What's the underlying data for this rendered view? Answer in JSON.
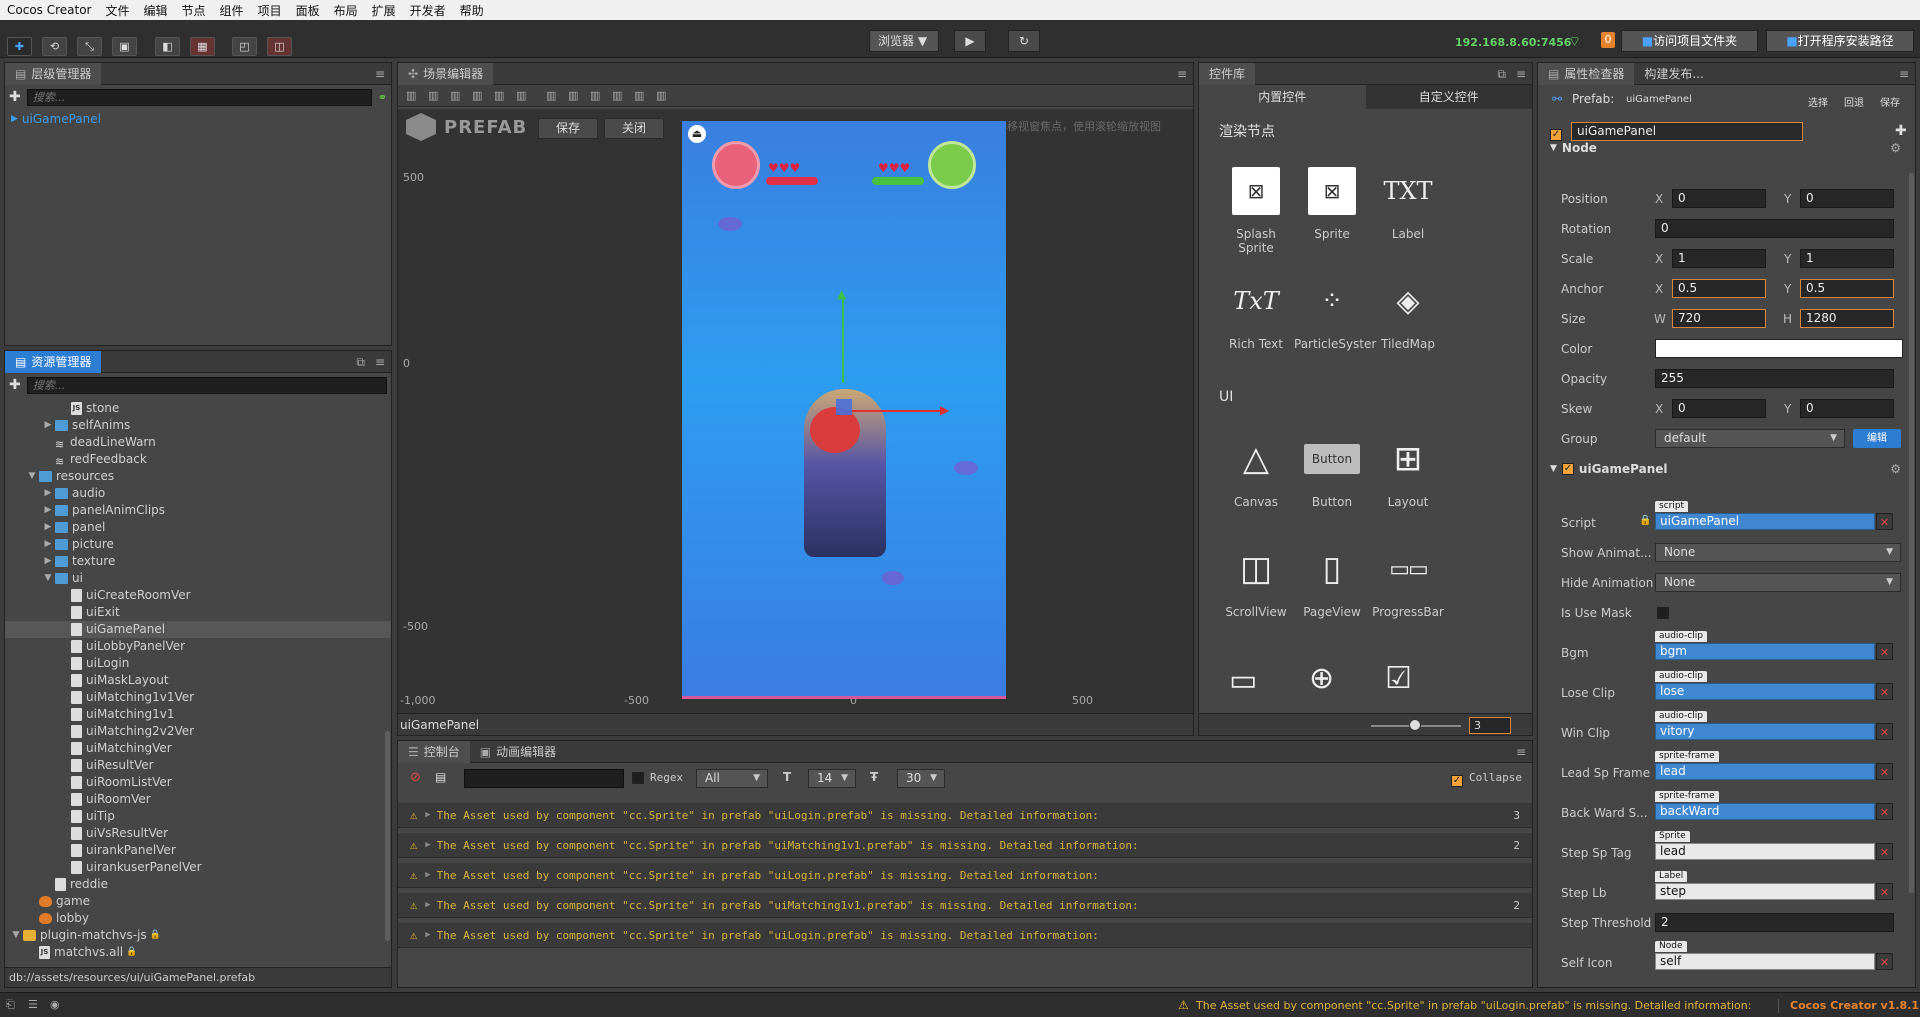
{
  "menubar": {
    "items": [
      "Cocos Creator",
      "文件",
      "编辑",
      "节点",
      "组件",
      "项目",
      "面板",
      "布局",
      "扩展",
      "开发者",
      "帮助"
    ]
  },
  "toolbar": {
    "browser_label": "浏览器",
    "ip": "192.168.8.60:7456",
    "notification_count": "0",
    "open_project_label": "访问项目文件夹",
    "open_install_label": "打开程序安装路径"
  },
  "hierarchy": {
    "title": "层级管理器",
    "search_placeholder": "搜索...",
    "root": "uiGamePanel"
  },
  "assets": {
    "title": "资源管理器",
    "search_placeholder": "搜索...",
    "items": [
      {
        "label": "stone",
        "indent": 3,
        "kind": "js",
        "fold": ""
      },
      {
        "label": "selfAnims",
        "indent": 2,
        "kind": "folder",
        "fold": "▶"
      },
      {
        "label": "deadLineWarn",
        "indent": 2,
        "kind": "anim",
        "fold": ""
      },
      {
        "label": "redFeedback",
        "indent": 2,
        "kind": "anim",
        "fold": ""
      },
      {
        "label": "resources",
        "indent": 1,
        "kind": "folder",
        "fold": "▼"
      },
      {
        "label": "audio",
        "indent": 2,
        "kind": "folder",
        "fold": "▶"
      },
      {
        "label": "panelAnimClips",
        "indent": 2,
        "kind": "folder",
        "fold": "▶"
      },
      {
        "label": "panel",
        "indent": 2,
        "kind": "folder",
        "fold": "▶"
      },
      {
        "label": "picture",
        "indent": 2,
        "kind": "folder",
        "fold": "▶"
      },
      {
        "label": "texture",
        "indent": 2,
        "kind": "folder",
        "fold": "▶"
      },
      {
        "label": "ui",
        "indent": 2,
        "kind": "folder",
        "fold": "▼"
      },
      {
        "label": "uiCreateRoomVer",
        "indent": 3,
        "kind": "file",
        "fold": ""
      },
      {
        "label": "uiExit",
        "indent": 3,
        "kind": "file",
        "fold": ""
      },
      {
        "label": "uiGamePanel",
        "indent": 3,
        "kind": "file",
        "fold": "",
        "selected": true
      },
      {
        "label": "uiLobbyPanelVer",
        "indent": 3,
        "kind": "file",
        "fold": ""
      },
      {
        "label": "uiLogin",
        "indent": 3,
        "kind": "file",
        "fold": ""
      },
      {
        "label": "uiMaskLayout",
        "indent": 3,
        "kind": "file",
        "fold": ""
      },
      {
        "label": "uiMatching1v1Ver",
        "indent": 3,
        "kind": "file",
        "fold": ""
      },
      {
        "label": "uiMatching1v1",
        "indent": 3,
        "kind": "file",
        "fold": ""
      },
      {
        "label": "uiMatching2v2Ver",
        "indent": 3,
        "kind": "file",
        "fold": ""
      },
      {
        "label": "uiMatchingVer",
        "indent": 3,
        "kind": "file",
        "fold": ""
      },
      {
        "label": "uiResultVer",
        "indent": 3,
        "kind": "file",
        "fold": ""
      },
      {
        "label": "uiRoomListVer",
        "indent": 3,
        "kind": "file",
        "fold": ""
      },
      {
        "label": "uiRoomVer",
        "indent": 3,
        "kind": "file",
        "fold": ""
      },
      {
        "label": "uiTip",
        "indent": 3,
        "kind": "file",
        "fold": ""
      },
      {
        "label": "uiVsResultVer",
        "indent": 3,
        "kind": "file",
        "fold": ""
      },
      {
        "label": "uirankPanelVer",
        "indent": 3,
        "kind": "file",
        "fold": ""
      },
      {
        "label": "uirankuserPanelVer",
        "indent": 3,
        "kind": "file",
        "fold": ""
      },
      {
        "label": "reddie",
        "indent": 2,
        "kind": "file",
        "fold": ""
      },
      {
        "label": "game",
        "indent": 1,
        "kind": "fire",
        "fold": ""
      },
      {
        "label": "lobby",
        "indent": 1,
        "kind": "fire",
        "fold": ""
      },
      {
        "label": "plugin-matchvs-js",
        "indent": 0,
        "kind": "pkg",
        "fold": "▼",
        "locked": true
      },
      {
        "label": "matchvs.all",
        "indent": 1,
        "kind": "js",
        "fold": "",
        "locked": true
      }
    ],
    "path": "db://assets/resources/ui/uiGamePanel.prefab"
  },
  "scene": {
    "title": "场景编辑器",
    "prefab_label": "PREFAB",
    "save_label": "保存",
    "close_label": "关闭",
    "hint": "使用鼠标右键平移视窗焦点，使用滚轮缩放视图",
    "ruler_y": [
      "500",
      "0",
      "-500",
      "-1,000"
    ],
    "ruler_x": [
      "-500",
      "0",
      "500"
    ],
    "footer_name": "uiGamePanel"
  },
  "library": {
    "title": "控件库",
    "tab_builtin": "内置控件",
    "tab_custom": "自定义控件",
    "section_render": "渲染节点",
    "section_ui": "UI",
    "render_items": [
      "Splash Sprite",
      "Sprite",
      "Label",
      "Rich Text",
      "ParticleSyster",
      "TiledMap"
    ],
    "ui_items": [
      "Canvas",
      "Button",
      "Layout",
      "ScrollView",
      "PageView",
      "ProgressBar"
    ],
    "label_icon_text": "TXT",
    "richtext_icon_text": "TxT",
    "button_icon_text": "Button",
    "zoom_value": "3"
  },
  "console": {
    "tab_console": "控制台",
    "tab_anim": "动画编辑器",
    "regex_label": "Regex",
    "filter_value": "All",
    "font_size": "14",
    "line_height": "30",
    "collapse_label": "Collapse",
    "logs": [
      {
        "text": "The Asset used by component \"cc.Sprite\" in prefab \"uiLogin.prefab\" is missing. Detailed information:",
        "count": "3"
      },
      {
        "text": "The Asset used by component \"cc.Sprite\" in prefab \"uiMatching1v1.prefab\" is missing. Detailed information:",
        "count": "2"
      },
      {
        "text": "The Asset used by component \"cc.Sprite\" in prefab \"uiLogin.prefab\" is missing. Detailed information:",
        "count": ""
      },
      {
        "text": "The Asset used by component \"cc.Sprite\" in prefab \"uiMatching1v1.prefab\" is missing. Detailed information:",
        "count": "2"
      },
      {
        "text": "The Asset used by component \"cc.Sprite\" in prefab \"uiLogin.prefab\" is missing. Detailed information:",
        "count": ""
      }
    ]
  },
  "inspector": {
    "tab_props": "属性检查器",
    "tab_build": "构建发布...",
    "prefab_label": "Prefab:",
    "prefab_name": "uiGamePanel",
    "select_label": "选择",
    "revert_label": "回退",
    "save_label": "保存",
    "node_name": "uiGamePanel",
    "node_section": "Node",
    "position_label": "Position",
    "position_x": "0",
    "position_y": "0",
    "rotation_label": "Rotation",
    "rotation": "0",
    "scale_label": "Scale",
    "scale_x": "1",
    "scale_y": "1",
    "anchor_label": "Anchor",
    "anchor_x": "0.5",
    "anchor_y": "0.5",
    "size_label": "Size",
    "size_w": "720",
    "size_h": "1280",
    "color_label": "Color",
    "color_value": "#ffffff",
    "opacity_label": "Opacity",
    "opacity": "255",
    "skew_label": "Skew",
    "skew_x": "0",
    "skew_y": "0",
    "group_label": "Group",
    "group_value": "default",
    "group_edit": "编辑",
    "component_name": "uiGamePanel",
    "script_label": "Script",
    "script_tag": "script",
    "script_value": "uiGamePanel",
    "show_anim_label": "Show Animat...",
    "show_anim_value": "None",
    "hide_anim_label": "Hide Animation",
    "hide_anim_value": "None",
    "mask_label": "Is Use Mask",
    "bgm_label": "Bgm",
    "bgm_tag": "audio-clip",
    "bgm_value": "bgm",
    "lose_label": "Lose Clip",
    "lose_tag": "audio-clip",
    "lose_value": "lose",
    "win_label": "Win Clip",
    "win_tag": "audio-clip",
    "win_value": "vitory",
    "leadsp_label": "Lead Sp Frame",
    "leadsp_tag": "sprite-frame",
    "leadsp_value": "lead",
    "backward_label": "Back Ward S...",
    "backward_tag": "sprite-frame",
    "backward_value": "backWard",
    "steptag_label": "Step Sp Tag",
    "steptag_tag": "Sprite",
    "steptag_value": "lead",
    "steplb_label": "Step Lb",
    "steplb_tag": "Label",
    "steplb_value": "step",
    "threshold_label": "Step Threshold",
    "threshold_value": "2",
    "selficon_label": "Self Icon",
    "selficon_tag": "Node",
    "selficon_value": "self",
    "x": "X",
    "y": "Y",
    "w": "W",
    "h": "H"
  },
  "statusbar": {
    "message": "The Asset used by component \"cc.Sprite\" in prefab \"uiLogin.prefab\" is missing. Detailed information:",
    "version": "Cocos Creator v1.8.1"
  },
  "colors": {
    "accent": "#2d7dd2",
    "warning": "#f2c230",
    "orange": "#d7873c",
    "ip_green": "#66d166"
  }
}
